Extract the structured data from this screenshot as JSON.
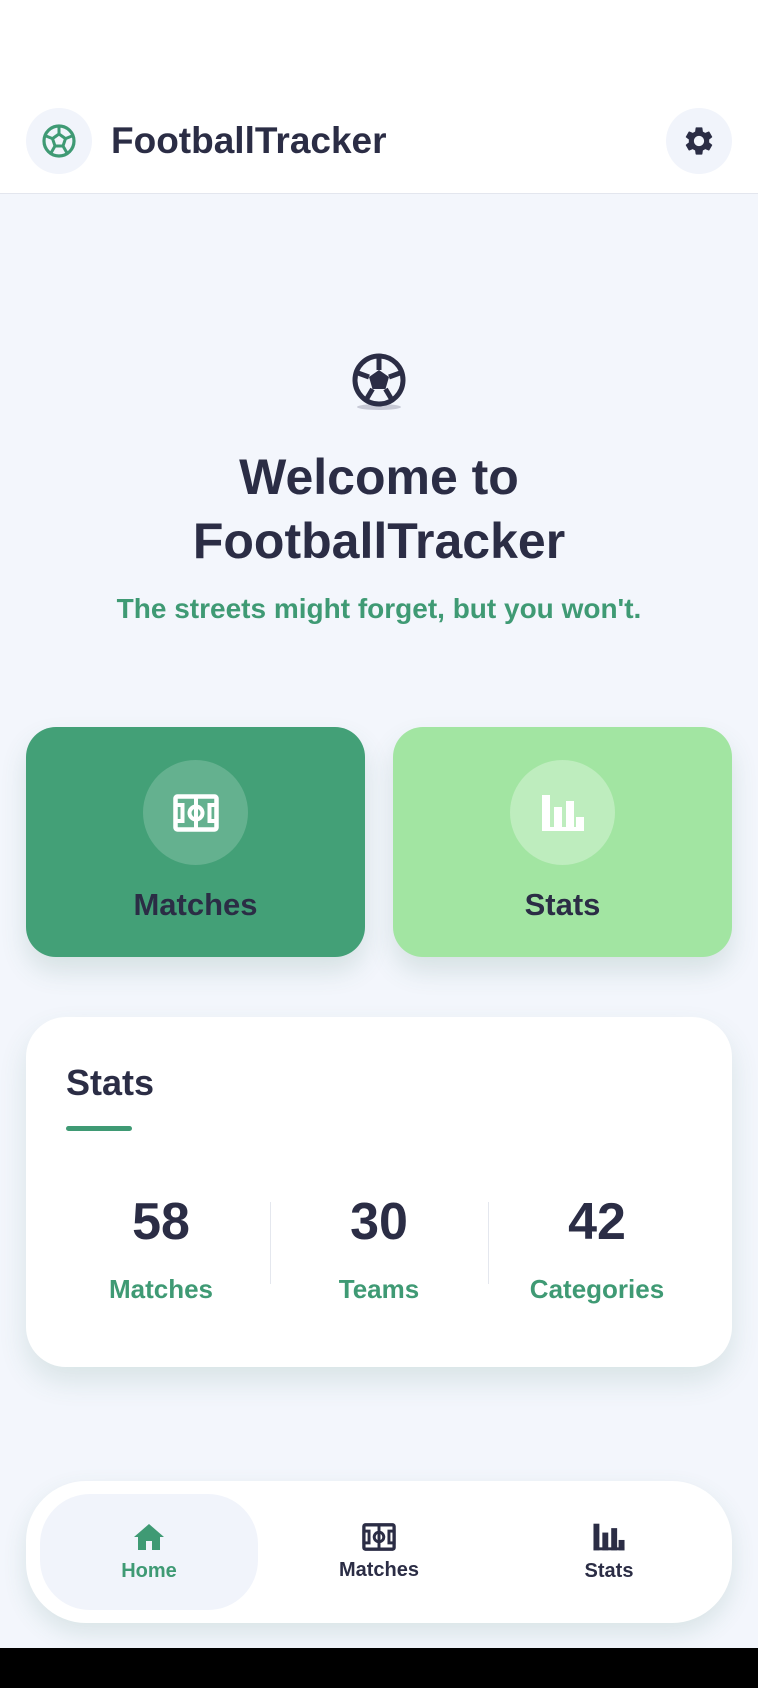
{
  "app": {
    "title": "FootballTracker"
  },
  "hero": {
    "title_line1": "Welcome to",
    "title_line2": "FootballTracker",
    "subtitle": "The streets might forget, but you won't."
  },
  "cards": [
    {
      "label": "Matches",
      "icon": "soccer-field-icon"
    },
    {
      "label": "Stats",
      "icon": "bar-chart-icon"
    }
  ],
  "stats": {
    "heading": "Stats",
    "items": [
      {
        "value": "58",
        "label": "Matches"
      },
      {
        "value": "30",
        "label": "Teams"
      },
      {
        "value": "42",
        "label": "Categories"
      }
    ]
  },
  "nav": [
    {
      "label": "Home",
      "icon": "home-icon",
      "active": true
    },
    {
      "label": "Matches",
      "icon": "soccer-field-icon",
      "active": false
    },
    {
      "label": "Stats",
      "icon": "bar-chart-icon",
      "active": false
    }
  ],
  "colors": {
    "accent": "#3f9a74",
    "primary_card": "#43a077",
    "secondary_card": "#a2e5a2",
    "text": "#2b2d45",
    "background": "#f3f6fc"
  }
}
